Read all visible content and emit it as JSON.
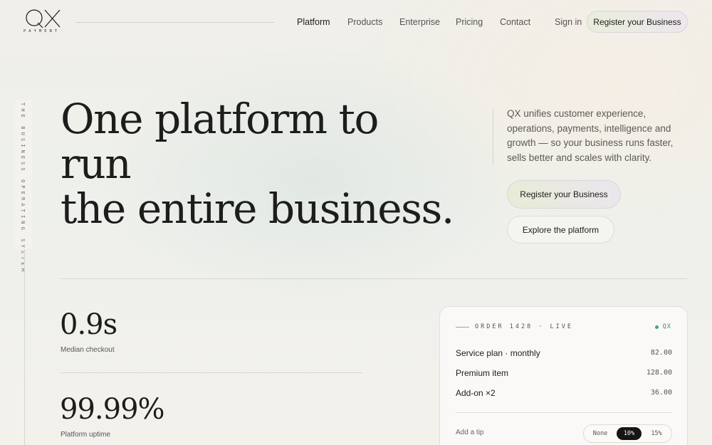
{
  "header": {
    "logo_mark": "QX",
    "logo_subtitle": "PAYMENT",
    "nav": [
      "Platform",
      "Products",
      "Enterprise",
      "Pricing",
      "Contact"
    ],
    "sign_in": "Sign in",
    "register_button": "Register your Business"
  },
  "side_label": "THE BUSINESS OPERATING SYSTEM",
  "hero": {
    "title_line1": "One platform to run",
    "title_line2": "the entire business.",
    "description": "QX unifies customer experience, operations, payments, intelligence and growth — so your business runs faster, sells better and scales with clarity.",
    "primary_button": "Register your Business",
    "secondary_button": "Explore the platform"
  },
  "stats": [
    {
      "value": "0.9s",
      "label": "Median checkout"
    },
    {
      "value": "99.99%",
      "label": "Platform uptime"
    }
  ],
  "order_card": {
    "order_label": "ORDER 1428 · LIVE",
    "brand": "QX",
    "items": [
      {
        "name": "Service plan · monthly",
        "amount": "82.00"
      },
      {
        "name": "Premium item",
        "amount": "128.00"
      },
      {
        "name": "Add-on ×2",
        "amount": "36.00"
      }
    ],
    "tip_label": "Add a tip",
    "tip_options": [
      "None",
      "10%",
      "15%"
    ],
    "tip_selected": "10%"
  },
  "colors": {
    "accent_green": "#4aa37a",
    "selected_dark": "#151515",
    "button_gradient_start": "#e7ecd6",
    "button_gradient_end": "#ebe5ed"
  }
}
